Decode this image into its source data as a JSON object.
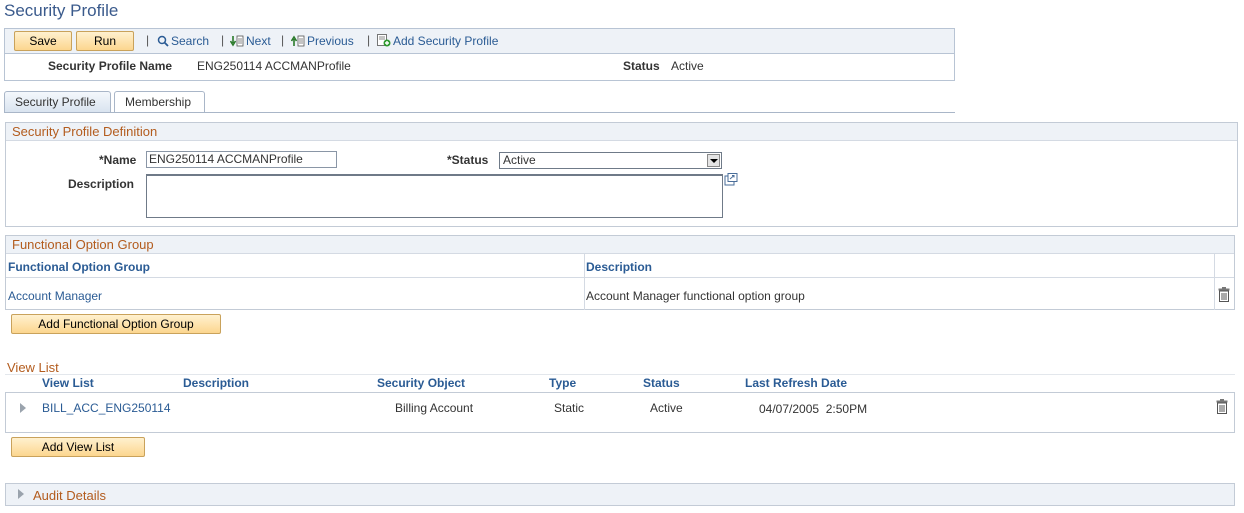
{
  "page": {
    "title": "Security Profile"
  },
  "toolbar": {
    "save_label": "Save",
    "run_label": "Run",
    "search_label": "Search",
    "next_label": "Next",
    "previous_label": "Previous",
    "add_label": "Add Security Profile",
    "separator": "|"
  },
  "header": {
    "name_label": "Security Profile Name",
    "name_value": "ENG250114 ACCMANProfile",
    "status_label": "Status",
    "status_value": "Active"
  },
  "tabs": [
    {
      "label": "Security Profile",
      "active": true
    },
    {
      "label": "Membership",
      "active": false
    }
  ],
  "definition": {
    "title": "Security Profile Definition",
    "name_label": "*Name",
    "name_value": "ENG250114 ACCMANProfile",
    "status_label": "*Status",
    "status_value": "Active",
    "description_label": "Description",
    "description_value": ""
  },
  "fog": {
    "title": "Functional Option Group",
    "columns": [
      "Functional Option Group",
      "Description"
    ],
    "rows": [
      {
        "group": "Account Manager",
        "description": "Account Manager functional option group"
      }
    ],
    "add_label": "Add Functional Option Group"
  },
  "viewlist": {
    "title": "View List",
    "columns": [
      "View List",
      "Description",
      "Security Object",
      "Type",
      "Status",
      "Last Refresh Date"
    ],
    "rows": [
      {
        "name": "BILL_ACC_ENG250114",
        "description": "",
        "object": "Billing Account",
        "type": "Static",
        "status": "Active",
        "refresh": "04/07/2005  2:50PM"
      }
    ],
    "add_label": "Add View List"
  },
  "audit": {
    "title": "Audit Details"
  },
  "colors": {
    "link": "#2a5b94",
    "section": "#b35c1e",
    "button": "#fcd68f"
  }
}
